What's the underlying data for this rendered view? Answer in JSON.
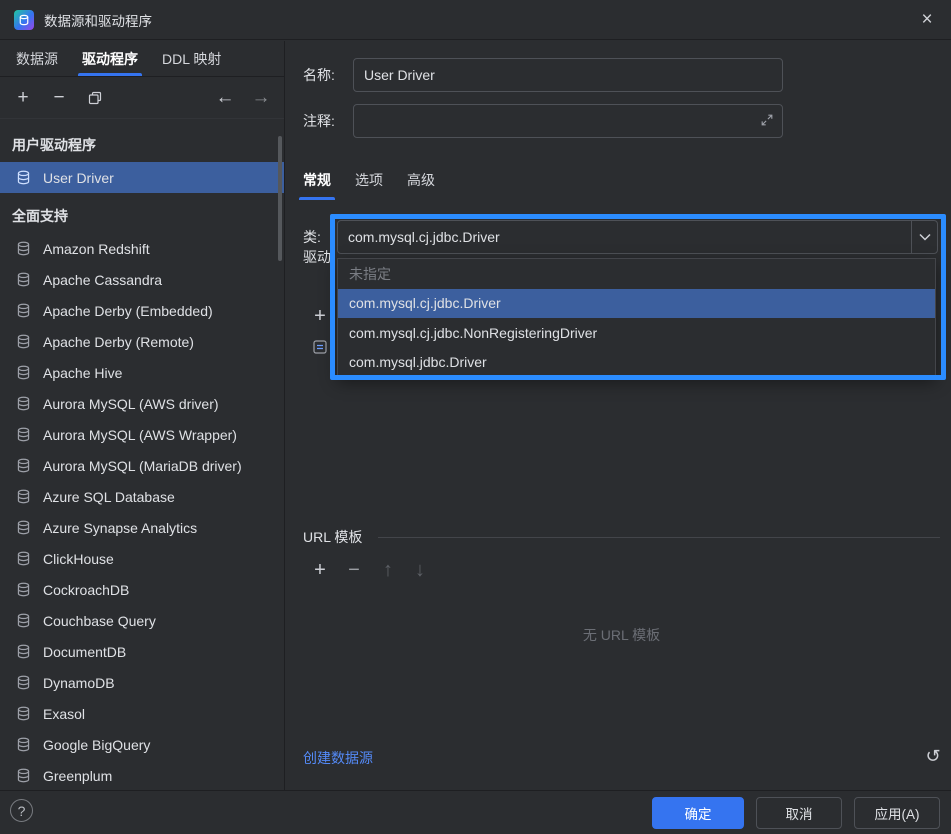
{
  "window": {
    "title": "数据源和驱动程序",
    "close_glyph": "×"
  },
  "left_tabs": [
    {
      "label": "数据源",
      "active": false
    },
    {
      "label": "驱动程序",
      "active": true
    },
    {
      "label": "DDL 映射",
      "active": false
    }
  ],
  "sidebar_toolbar": {
    "add": "+",
    "remove": "−",
    "back": "←",
    "forward": "→"
  },
  "sidebar": {
    "groups": [
      {
        "header": "用户驱动程序",
        "items": [
          {
            "label": "User Driver",
            "selected": true,
            "icon": "user-driver-icon"
          }
        ]
      },
      {
        "header": "全面支持",
        "items": [
          {
            "label": "Amazon Redshift",
            "icon": "redshift-icon"
          },
          {
            "label": "Apache Cassandra",
            "icon": "cassandra-icon"
          },
          {
            "label": "Apache Derby (Embedded)",
            "icon": "derby-embedded-icon"
          },
          {
            "label": "Apache Derby (Remote)",
            "icon": "derby-remote-icon"
          },
          {
            "label": "Apache Hive",
            "icon": "hive-icon"
          },
          {
            "label": "Aurora MySQL (AWS driver)",
            "icon": "aurora-mysql-icon"
          },
          {
            "label": "Aurora MySQL (AWS Wrapper)",
            "icon": "aurora-mysql-icon"
          },
          {
            "label": "Aurora MySQL (MariaDB driver)",
            "icon": "aurora-mysql-icon"
          },
          {
            "label": "Azure SQL Database",
            "icon": "azure-sql-icon"
          },
          {
            "label": "Azure Synapse Analytics",
            "icon": "azure-synapse-icon"
          },
          {
            "label": "ClickHouse",
            "icon": "clickhouse-icon"
          },
          {
            "label": "CockroachDB",
            "icon": "cockroachdb-icon"
          },
          {
            "label": "Couchbase Query",
            "icon": "couchbase-icon"
          },
          {
            "label": "DocumentDB",
            "icon": "documentdb-icon"
          },
          {
            "label": "DynamoDB",
            "icon": "dynamodb-icon"
          },
          {
            "label": "Exasol",
            "icon": "exasol-icon"
          },
          {
            "label": "Google BigQuery",
            "icon": "bigquery-icon"
          },
          {
            "label": "Greenplum",
            "icon": "greenplum-icon"
          }
        ]
      }
    ]
  },
  "form": {
    "name_label": "名称:",
    "name_value": "User Driver",
    "comment_label": "注释:",
    "comment_value": "",
    "tabs": [
      {
        "label": "常规",
        "active": true
      },
      {
        "label": "选项",
        "active": false
      },
      {
        "label": "高级",
        "active": false
      }
    ],
    "class_label": "类:",
    "class_value": "com.mysql.cj.jdbc.Driver",
    "driver_files_label": "驱动"
  },
  "class_dropdown": {
    "options": [
      {
        "label": "未指定",
        "muted": true
      },
      {
        "label": "com.mysql.cj.jdbc.Driver",
        "selected": true
      },
      {
        "label": "com.mysql.cj.jdbc.NonRegisteringDriver"
      },
      {
        "label": "com.mysql.jdbc.Driver"
      }
    ]
  },
  "url_templates": {
    "title": "URL 模板",
    "empty_text": "无 URL 模板",
    "toolbar": {
      "add": "+",
      "remove": "−",
      "up": "↑",
      "down": "↓"
    }
  },
  "footer_link": {
    "create_data_source": "创建数据源",
    "undo_glyph": "↺"
  },
  "buttons": {
    "ok": "确定",
    "cancel": "取消",
    "apply": "应用(A)",
    "help": "?"
  },
  "colors": {
    "accent": "#3574f0",
    "selection": "#3c5f9e",
    "annotation_border": "#2b8cff",
    "link": "#548af7",
    "primary_button": "#3574f0"
  }
}
